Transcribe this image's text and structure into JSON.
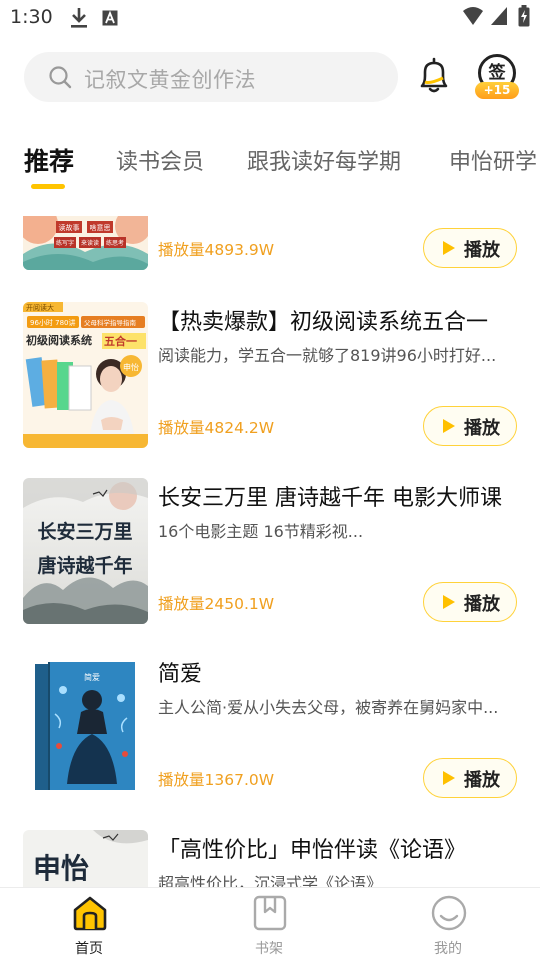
{
  "status_bar": {
    "time": "1:30"
  },
  "header": {
    "search_placeholder": "记叙文黄金创作法",
    "signin_label": "签",
    "signin_badge": "+15"
  },
  "tabs": [
    {
      "label": "推荐",
      "active": true
    },
    {
      "label": "读书会员",
      "active": false
    },
    {
      "label": "跟我读好每学期",
      "active": false
    },
    {
      "label": "申怡研学",
      "active": false
    }
  ],
  "play_button_label": "播放",
  "items": [
    {
      "title": "",
      "desc": "",
      "plays": "播放量4893.9W",
      "cover_texts": [
        "读故事",
        "啥意思",
        "练写字",
        "来读读",
        "练思考"
      ]
    },
    {
      "title": "【热卖爆款】初级阅读系统五合一",
      "desc": "阅读能力，学五合一就够了819讲96小时打好...",
      "plays": "播放量4824.2W",
      "cover_texts": [
        "开阅读大",
        "96小时 780讲",
        "父母科学指导指南",
        "初级阅读系统",
        "五合一",
        "申怡"
      ]
    },
    {
      "title": "长安三万里 唐诗越千年 电影大师课",
      "desc": "16个电影主题 16节精彩视...",
      "plays": "播放量2450.1W",
      "cover_texts": [
        "长安三万里",
        "唐诗越千年"
      ]
    },
    {
      "title": "简爱",
      "desc": "主人公简·爱从小失去父母，被寄养在舅妈家中...",
      "plays": "播放量1367.0W",
      "cover_texts": [
        "简爱"
      ]
    },
    {
      "title": "「高性价比」申怡伴读《论语》",
      "desc": "超高性价比，沉浸式学《论语》",
      "plays": "",
      "cover_texts": [
        "申怡"
      ]
    }
  ],
  "bottom_nav": [
    {
      "label": "首页",
      "icon": "home-icon",
      "active": true
    },
    {
      "label": "书架",
      "icon": "bookshelf-icon",
      "active": false
    },
    {
      "label": "我的",
      "icon": "profile-icon",
      "active": false
    }
  ],
  "colors": {
    "accent": "#ffc400",
    "plays": "#f0a020"
  }
}
